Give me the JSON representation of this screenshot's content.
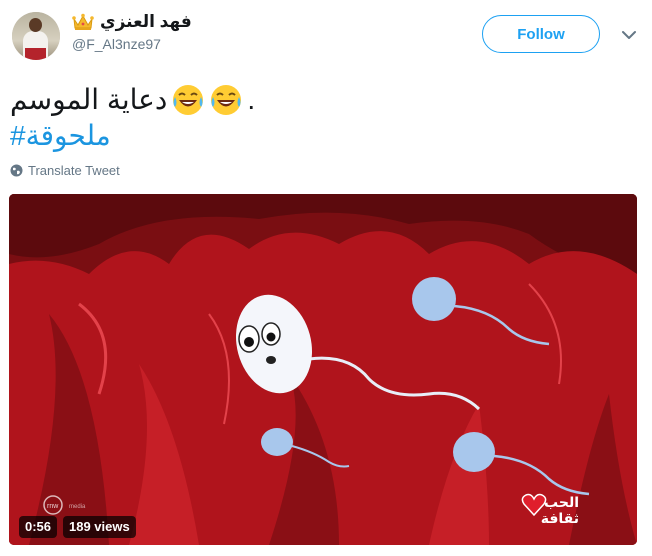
{
  "user": {
    "display_name": "فهد العنزي",
    "handle": "@F_Al3nze97",
    "name_emoji": "crown-icon"
  },
  "header": {
    "follow_label": "Follow",
    "menu_icon": "chevron-down-icon"
  },
  "tweet": {
    "text": "دعاية الموسم",
    "trailing_period": ".",
    "emojis": [
      "face-with-tears-of-joy",
      "face-with-tears-of-joy"
    ],
    "hashtag": "#ملحوقة",
    "translate_label": "Translate Tweet"
  },
  "media": {
    "duration": "0:56",
    "views": "189 views",
    "channel_logo_text": "الحب ثقافة",
    "watermark_text": "rnw media"
  },
  "colors": {
    "accent": "#1da1f2",
    "hashtag": "#1b95e0",
    "muted": "#657786",
    "video_bg": "#7f0f14"
  }
}
